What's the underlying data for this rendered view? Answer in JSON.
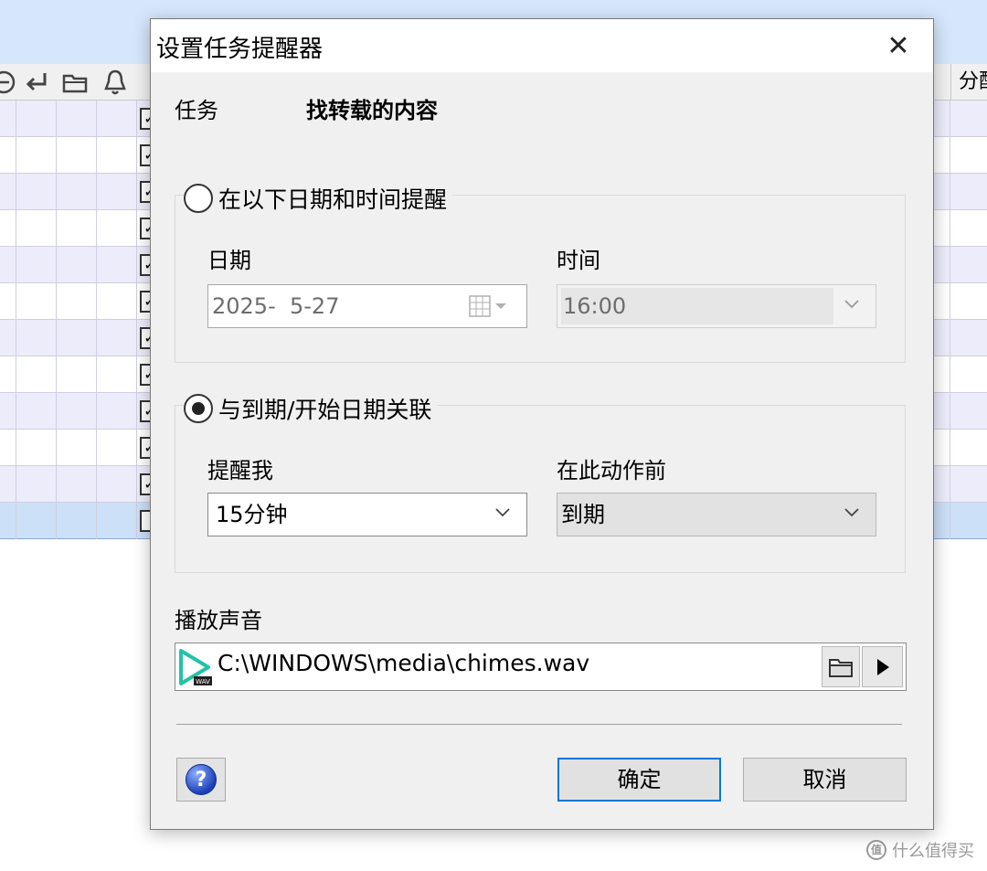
{
  "background": {
    "toolbar_icons": [
      "minus-circle-icon",
      "return-arrow-icon",
      "folder-icon",
      "bell-icon"
    ],
    "column_header": "分配",
    "checkbox_mark": "✓",
    "rows": 12,
    "watermark": "什么值得买",
    "watermark_logo": "值"
  },
  "dialog": {
    "title": "设置任务提醒器",
    "close_glyph": "✕",
    "task_label": "任务",
    "task_value": "找转载的内容",
    "option1": {
      "label": "在以下日期和时间提醒",
      "checked": false,
      "date_label": "日期",
      "date_value": "2025-  5-27",
      "time_label": "时间",
      "time_value": "16:00"
    },
    "option2": {
      "label": "与到期/开始日期关联",
      "checked": true,
      "remind_label": "提醒我",
      "remind_value": "15分钟",
      "before_label": "在此动作前",
      "before_value": "到期"
    },
    "sound_label": "播放声音",
    "sound_path": "C:\\WINDOWS\\media\\chimes.wav",
    "sound_icon_badge": "WAV",
    "help_glyph": "?",
    "ok_label": "确定",
    "cancel_label": "取消",
    "colors": {
      "focus_border": "#0078d7",
      "selected_row": "#cce0f8",
      "sound_icon_accent": "#22c3a6"
    }
  }
}
